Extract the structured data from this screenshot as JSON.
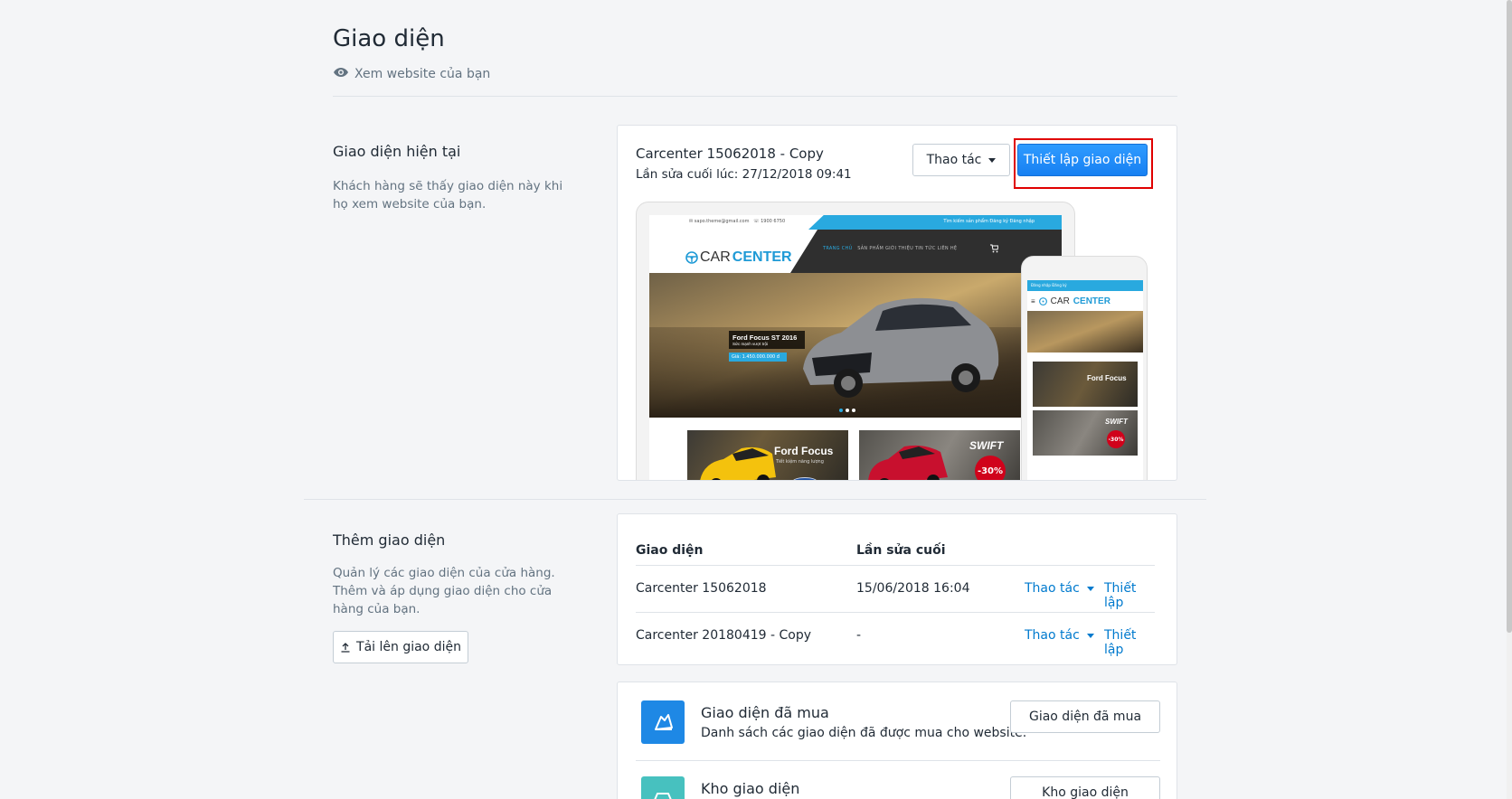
{
  "page": {
    "title": "Giao diện",
    "view_site": "Xem website của bạn"
  },
  "current_theme": {
    "section_title": "Giao diện hiện tại",
    "section_desc": "Khách hàng sẽ thấy giao diện này khi họ xem website của bạn.",
    "theme_name": "Carcenter 15062018 - Copy",
    "last_edited": "Lần sửa cuối lúc: 27/12/2018 09:41",
    "actions_label": "Thao tác",
    "customize_label": "Thiết lập giao diện",
    "preview": {
      "email": "✉ sapo.theme@gmail.com",
      "phone": "☏ 1900 6750",
      "links": "Tìm kiếm sản phẩm   Đăng ký   Đăng nhập",
      "logo_plain": "CAR",
      "logo_bold": "CENTER",
      "menu_active": "TRANG CHỦ",
      "menu": "SẢN PHẨM    GIỚI THIỆU    TIN TỨC    LIÊN HỆ",
      "hero_title": "Ford Focus ST 2016",
      "hero_sub": "Sức mạnh vượt trội",
      "hero_price": "Giá: 1.450.000.000 đ",
      "thumb1_title": "Ford Focus",
      "thumb1_sub": "Tiết kiệm năng lượng",
      "thumb2_title": "SWIFT",
      "thumb2_badge": "-30%",
      "phone_links": "Đăng nhập   Đăng ký"
    }
  },
  "add_theme": {
    "section_title": "Thêm giao diện",
    "section_desc": "Quản lý các giao diện của cửa hàng. Thêm và áp dụng giao diện cho cửa hàng của bạn.",
    "upload_label": "Tải lên giao diện",
    "table": {
      "headers": [
        "Giao diện",
        "Lần sửa cuối"
      ],
      "rows": [
        {
          "name": "Carcenter 15062018",
          "edited": "15/06/2018 16:04",
          "actions": "Thao tác",
          "publish": "Thiết lập"
        },
        {
          "name": "Carcenter 20180419 - Copy",
          "edited": "-",
          "actions": "Thao tác",
          "publish": "Thiết lập"
        }
      ]
    }
  },
  "purchased": {
    "title": "Giao diện đã mua",
    "desc": "Danh sách các giao diện đã được mua cho website.",
    "button": "Giao diện đã mua",
    "icon": "hand-purchase-icon",
    "icon_color": "#1e88e5"
  },
  "store": {
    "title": "Kho giao diện",
    "button": "Kho giao diện",
    "icon": "car-icon",
    "icon_color": "#47c1bf"
  },
  "colors": {
    "primary": "#1780f2",
    "link": "#007ace",
    "highlight": "#e00000"
  }
}
